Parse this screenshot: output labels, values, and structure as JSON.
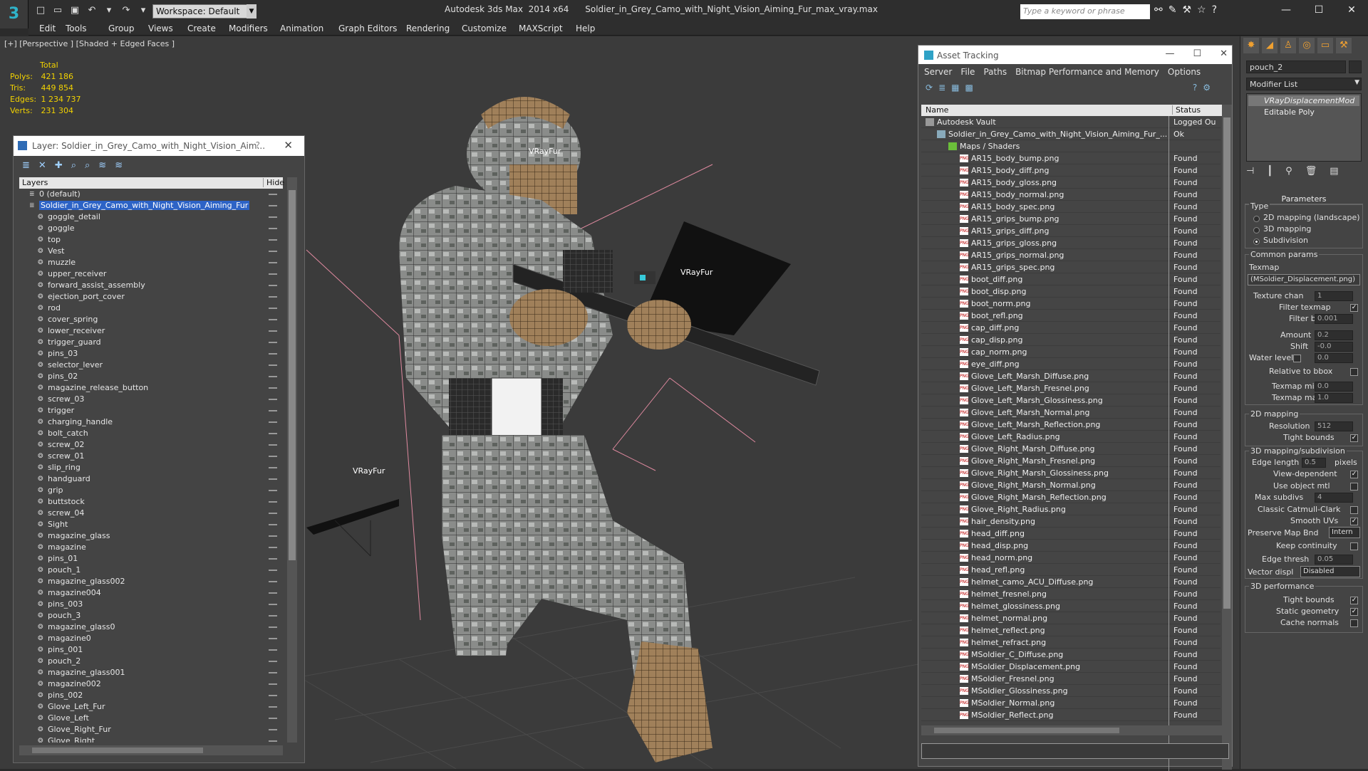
{
  "app": {
    "title": "Autodesk 3ds Max  2014 x64      Soldier_in_Grey_Camo_with_Night_Vision_Aiming_Fur_max_vray.max",
    "workspace": "Workspace: Default",
    "search_placeholder": "Type a keyword or phrase"
  },
  "menu": [
    "Edit",
    "Tools",
    "Group",
    "Views",
    "Create",
    "Modifiers",
    "Animation",
    "Graph Editors",
    "Rendering",
    "Customize",
    "MAXScript",
    "Help"
  ],
  "viewport": {
    "label": "[+] [Perspective ] [Shaded + Edged Faces ]",
    "stats_header": "Total",
    "stats": [
      {
        "label": "Polys:",
        "value": "421 186"
      },
      {
        "label": "Tris:",
        "value": "449 854"
      },
      {
        "label": "Edges:",
        "value": "1 234 737"
      },
      {
        "label": "Verts:",
        "value": "231 304"
      }
    ],
    "fur_labels": [
      "VRayFur",
      "VRayFur",
      "VRayFur"
    ]
  },
  "layer_window": {
    "title": "Layer: Soldier_in_Grey_Camo_with_Night_Vision_Aim...",
    "help": "?",
    "col_layers": "Layers",
    "col_hide": "Hide",
    "rows": [
      {
        "name": "0 (default)",
        "level": 0
      },
      {
        "name": "Soldier_in_Grey_Camo_with_Night_Vision_Aiming_Fur",
        "level": 0,
        "selected": true
      },
      {
        "name": "goggle_detail",
        "level": 1
      },
      {
        "name": "goggle",
        "level": 1
      },
      {
        "name": "top",
        "level": 1
      },
      {
        "name": "Vest",
        "level": 1
      },
      {
        "name": "muzzle",
        "level": 1
      },
      {
        "name": "upper_receiver",
        "level": 1
      },
      {
        "name": "forward_assist_assembly",
        "level": 1
      },
      {
        "name": "ejection_port_cover",
        "level": 1
      },
      {
        "name": "rod",
        "level": 1
      },
      {
        "name": "cover_spring",
        "level": 1
      },
      {
        "name": "lower_receiver",
        "level": 1
      },
      {
        "name": "trigger_guard",
        "level": 1
      },
      {
        "name": "pins_03",
        "level": 1
      },
      {
        "name": "selector_lever",
        "level": 1
      },
      {
        "name": "pins_02",
        "level": 1
      },
      {
        "name": "magazine_release_button",
        "level": 1
      },
      {
        "name": "screw_03",
        "level": 1
      },
      {
        "name": "trigger",
        "level": 1
      },
      {
        "name": "charging_handle",
        "level": 1
      },
      {
        "name": "bolt_catch",
        "level": 1
      },
      {
        "name": "screw_02",
        "level": 1
      },
      {
        "name": "screw_01",
        "level": 1
      },
      {
        "name": "slip_ring",
        "level": 1
      },
      {
        "name": "handguard",
        "level": 1
      },
      {
        "name": "grip",
        "level": 1
      },
      {
        "name": "buttstock",
        "level": 1
      },
      {
        "name": "screw_04",
        "level": 1
      },
      {
        "name": "Sight",
        "level": 1
      },
      {
        "name": "magazine_glass",
        "level": 1
      },
      {
        "name": "magazine",
        "level": 1
      },
      {
        "name": "pins_01",
        "level": 1
      },
      {
        "name": "pouch_1",
        "level": 1
      },
      {
        "name": "magazine_glass002",
        "level": 1
      },
      {
        "name": "magazine004",
        "level": 1
      },
      {
        "name": "pins_003",
        "level": 1
      },
      {
        "name": "pouch_3",
        "level": 1
      },
      {
        "name": "magazine_glass0",
        "level": 1
      },
      {
        "name": "magazine0",
        "level": 1
      },
      {
        "name": "pins_001",
        "level": 1
      },
      {
        "name": "pouch_2",
        "level": 1
      },
      {
        "name": "magazine_glass001",
        "level": 1
      },
      {
        "name": "magazine002",
        "level": 1
      },
      {
        "name": "pins_002",
        "level": 1
      },
      {
        "name": "Glove_Left_Fur",
        "level": 1
      },
      {
        "name": "Glove_Left",
        "level": 1
      },
      {
        "name": "Glove_Right_Fur",
        "level": 1
      },
      {
        "name": "Glove_Right",
        "level": 1
      }
    ]
  },
  "asset_tracking": {
    "title": "Asset Tracking",
    "menu": [
      "Server",
      "File",
      "Paths",
      "Bitmap Performance and Memory",
      "Options"
    ],
    "col_name": "Name",
    "col_status": "Status",
    "rows": [
      {
        "name": "Autodesk Vault",
        "status": "Logged Ou",
        "level": 0,
        "kind": "vault"
      },
      {
        "name": "Soldier_in_Grey_Camo_with_Night_Vision_Aiming_Fur_...",
        "status": "Ok",
        "level": 1,
        "kind": "file"
      },
      {
        "name": "Maps / Shaders",
        "status": "",
        "level": 2,
        "kind": "folder"
      },
      {
        "name": "AR15_body_bump.png",
        "status": "Found",
        "level": 3,
        "kind": "png"
      },
      {
        "name": "AR15_body_diff.png",
        "status": "Found",
        "level": 3,
        "kind": "png"
      },
      {
        "name": "AR15_body_gloss.png",
        "status": "Found",
        "level": 3,
        "kind": "png"
      },
      {
        "name": "AR15_body_normal.png",
        "status": "Found",
        "level": 3,
        "kind": "png"
      },
      {
        "name": "AR15_body_spec.png",
        "status": "Found",
        "level": 3,
        "kind": "png"
      },
      {
        "name": "AR15_grips_bump.png",
        "status": "Found",
        "level": 3,
        "kind": "png"
      },
      {
        "name": "AR15_grips_diff.png",
        "status": "Found",
        "level": 3,
        "kind": "png"
      },
      {
        "name": "AR15_grips_gloss.png",
        "status": "Found",
        "level": 3,
        "kind": "png"
      },
      {
        "name": "AR15_grips_normal.png",
        "status": "Found",
        "level": 3,
        "kind": "png"
      },
      {
        "name": "AR15_grips_spec.png",
        "status": "Found",
        "level": 3,
        "kind": "png"
      },
      {
        "name": "boot_diff.png",
        "status": "Found",
        "level": 3,
        "kind": "png"
      },
      {
        "name": "boot_disp.png",
        "status": "Found",
        "level": 3,
        "kind": "png"
      },
      {
        "name": "boot_norm.png",
        "status": "Found",
        "level": 3,
        "kind": "png"
      },
      {
        "name": "boot_refl.png",
        "status": "Found",
        "level": 3,
        "kind": "png"
      },
      {
        "name": "cap_diff.png",
        "status": "Found",
        "level": 3,
        "kind": "png"
      },
      {
        "name": "cap_disp.png",
        "status": "Found",
        "level": 3,
        "kind": "png"
      },
      {
        "name": "cap_norm.png",
        "status": "Found",
        "level": 3,
        "kind": "png"
      },
      {
        "name": "eye_diff.png",
        "status": "Found",
        "level": 3,
        "kind": "png"
      },
      {
        "name": "Glove_Left_Marsh_Diffuse.png",
        "status": "Found",
        "level": 3,
        "kind": "png"
      },
      {
        "name": "Glove_Left_Marsh_Fresnel.png",
        "status": "Found",
        "level": 3,
        "kind": "png"
      },
      {
        "name": "Glove_Left_Marsh_Glossiness.png",
        "status": "Found",
        "level": 3,
        "kind": "png"
      },
      {
        "name": "Glove_Left_Marsh_Normal.png",
        "status": "Found",
        "level": 3,
        "kind": "png"
      },
      {
        "name": "Glove_Left_Marsh_Reflection.png",
        "status": "Found",
        "level": 3,
        "kind": "png"
      },
      {
        "name": "Glove_Left_Radius.png",
        "status": "Found",
        "level": 3,
        "kind": "png"
      },
      {
        "name": "Glove_Right_Marsh_Diffuse.png",
        "status": "Found",
        "level": 3,
        "kind": "png"
      },
      {
        "name": "Glove_Right_Marsh_Fresnel.png",
        "status": "Found",
        "level": 3,
        "kind": "png"
      },
      {
        "name": "Glove_Right_Marsh_Glossiness.png",
        "status": "Found",
        "level": 3,
        "kind": "png"
      },
      {
        "name": "Glove_Right_Marsh_Normal.png",
        "status": "Found",
        "level": 3,
        "kind": "png"
      },
      {
        "name": "Glove_Right_Marsh_Reflection.png",
        "status": "Found",
        "level": 3,
        "kind": "png"
      },
      {
        "name": "Glove_Right_Radius.png",
        "status": "Found",
        "level": 3,
        "kind": "png"
      },
      {
        "name": "hair_density.png",
        "status": "Found",
        "level": 3,
        "kind": "png"
      },
      {
        "name": "head_diff.png",
        "status": "Found",
        "level": 3,
        "kind": "png"
      },
      {
        "name": "head_disp.png",
        "status": "Found",
        "level": 3,
        "kind": "png"
      },
      {
        "name": "head_norm.png",
        "status": "Found",
        "level": 3,
        "kind": "png"
      },
      {
        "name": "head_refl.png",
        "status": "Found",
        "level": 3,
        "kind": "png"
      },
      {
        "name": "helmet_camo_ACU_Diffuse.png",
        "status": "Found",
        "level": 3,
        "kind": "png"
      },
      {
        "name": "helmet_fresnel.png",
        "status": "Found",
        "level": 3,
        "kind": "png"
      },
      {
        "name": "helmet_glossiness.png",
        "status": "Found",
        "level": 3,
        "kind": "png"
      },
      {
        "name": "helmet_normal.png",
        "status": "Found",
        "level": 3,
        "kind": "png"
      },
      {
        "name": "helmet_reflect.png",
        "status": "Found",
        "level": 3,
        "kind": "png"
      },
      {
        "name": "helmet_refract.png",
        "status": "Found",
        "level": 3,
        "kind": "png"
      },
      {
        "name": "MSoldier_C_Diffuse.png",
        "status": "Found",
        "level": 3,
        "kind": "png"
      },
      {
        "name": "MSoldier_Displacement.png",
        "status": "Found",
        "level": 3,
        "kind": "png"
      },
      {
        "name": "MSoldier_Fresnel.png",
        "status": "Found",
        "level": 3,
        "kind": "png"
      },
      {
        "name": "MSoldier_Glossiness.png",
        "status": "Found",
        "level": 3,
        "kind": "png"
      },
      {
        "name": "MSoldier_Normal.png",
        "status": "Found",
        "level": 3,
        "kind": "png"
      },
      {
        "name": "MSoldier_Reflect.png",
        "status": "Found",
        "level": 3,
        "kind": "png"
      }
    ]
  },
  "command_panel": {
    "object_name": "pouch_2",
    "modifier_list": "Modifier List",
    "stack": [
      "VRayDisplacementMod",
      "Editable Poly"
    ],
    "parameters_title": "Parameters",
    "type_label": "Type",
    "type_options": [
      "2D mapping (landscape)",
      "3D mapping",
      "Subdivision"
    ],
    "type_selected": 2,
    "common_label": "Common params",
    "texmap_label": "Texmap",
    "texmap_value": "(MSoldier_Displacement.png)",
    "texture_chan_label": "Texture chan",
    "texture_chan": "1",
    "filter_texmap_label": "Filter texmap",
    "filter_texmap": true,
    "filter_blur_label": "Filter blur",
    "filter_blur": "0.001",
    "amount_label": "Amount",
    "amount": "0.2",
    "shift_label": "Shift",
    "shift": "-0.0",
    "water_level_label": "Water level",
    "water_level": "0.0",
    "relative_bbox_label": "Relative to bbox",
    "texmap_min_label": "Texmap min",
    "texmap_min": "0.0",
    "texmap_max_label": "Texmap max",
    "texmap_max": "1.0",
    "mapping2d_label": "2D mapping",
    "resolution_label": "Resolution",
    "resolution": "512",
    "tight_bounds_label": "Tight bounds",
    "mapping3d_label": "3D mapping/subdivision",
    "edge_length_label": "Edge length",
    "edge_length": "0.5",
    "pixels_label": "pixels",
    "view_dependent_label": "View-dependent",
    "use_object_mtl_label": "Use object mtl",
    "max_subdivs_label": "Max subdivs",
    "max_subdivs": "4",
    "classic_cc_label": "Classic Catmull-Clark",
    "smooth_uvs_label": "Smooth UVs",
    "preserve_map_label": "Preserve Map Bnd",
    "preserve_map": "Intern",
    "keep_continuity_label": "Keep continuity",
    "edge_thresh_label": "Edge thresh",
    "edge_thresh": "0.05",
    "vector_displ_label": "Vector displ",
    "vector_displ": "Disabled",
    "perf_label": "3D performance",
    "perf_tight_bounds_label": "Tight bounds",
    "static_geometry_label": "Static geometry",
    "cache_normals_label": "Cache normals"
  }
}
